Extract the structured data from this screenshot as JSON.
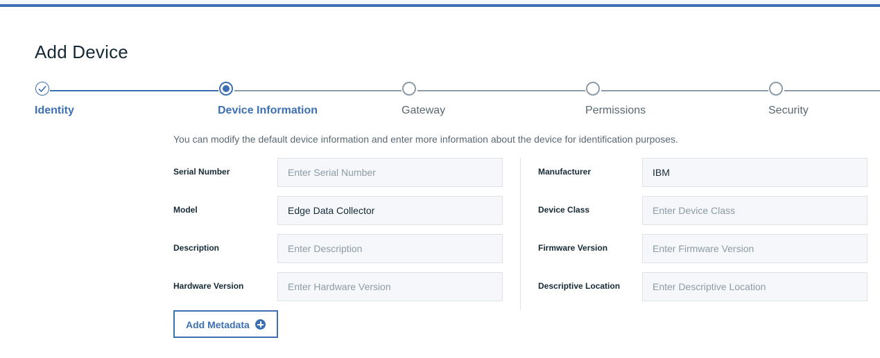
{
  "page": {
    "title": "Add Device",
    "intro": "You can modify the default device information and enter more information about the device for identification purposes."
  },
  "colors": {
    "accent": "#3d70b2",
    "text": "#152935",
    "muted": "#5a6872",
    "incomplete": "#8c9ba5",
    "input_bg": "#f5f7fa"
  },
  "progress": {
    "steps": [
      {
        "label": "Identity",
        "state": "complete",
        "icon": "checkmark-icon"
      },
      {
        "label": "Device Information",
        "state": "current",
        "icon": "current-dot-icon"
      },
      {
        "label": "Gateway",
        "state": "incomplete",
        "icon": "empty-circle-icon"
      },
      {
        "label": "Permissions",
        "state": "incomplete",
        "icon": "empty-circle-icon"
      },
      {
        "label": "Security",
        "state": "incomplete",
        "icon": "empty-circle-icon"
      }
    ]
  },
  "form": {
    "left": [
      {
        "label": "Serial Number",
        "value": "",
        "placeholder": "Enter Serial Number"
      },
      {
        "label": "Model",
        "value": "Edge Data Collector",
        "placeholder": ""
      },
      {
        "label": "Description",
        "value": "",
        "placeholder": "Enter Description"
      },
      {
        "label": "Hardware Version",
        "value": "",
        "placeholder": "Enter Hardware Version"
      }
    ],
    "right": [
      {
        "label": "Manufacturer",
        "value": "IBM",
        "placeholder": ""
      },
      {
        "label": "Device Class",
        "value": "",
        "placeholder": "Enter Device Class"
      },
      {
        "label": "Firmware Version",
        "value": "",
        "placeholder": "Enter Firmware Version"
      },
      {
        "label": "Descriptive Location",
        "value": "",
        "placeholder": "Enter Descriptive Location"
      }
    ]
  },
  "actions": {
    "add_metadata_label": "Add Metadata",
    "add_metadata_icon": "add-circle-icon"
  }
}
